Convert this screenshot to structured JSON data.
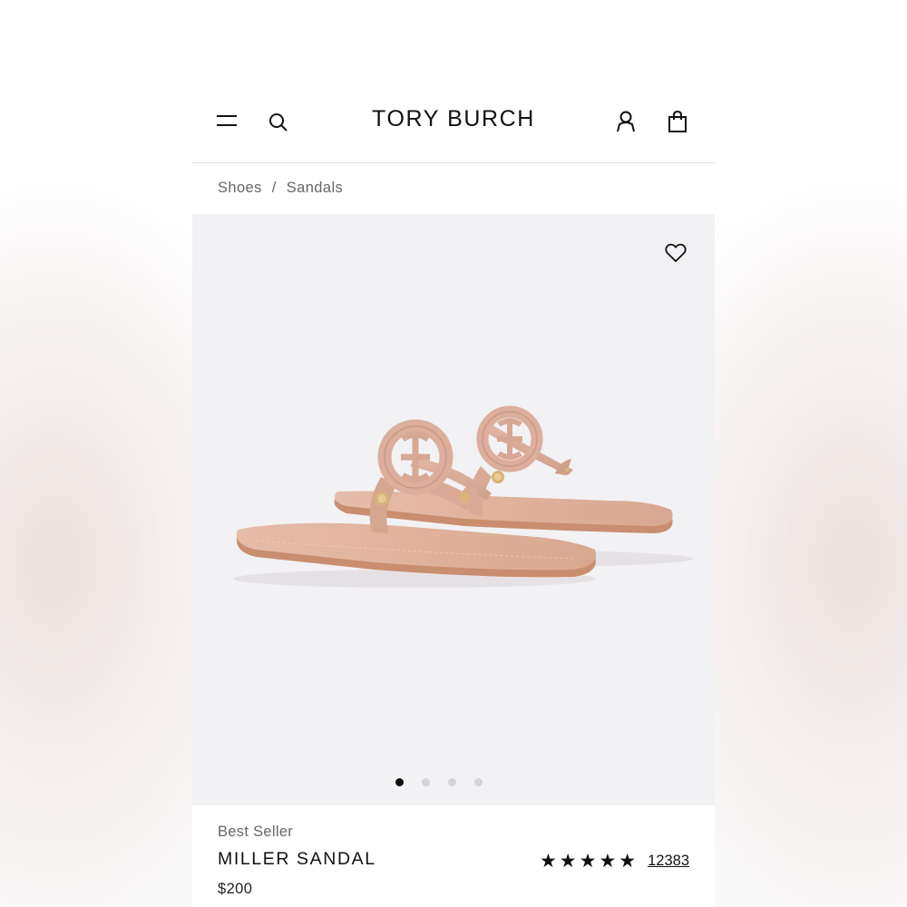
{
  "header": {
    "brand": "TORY BURCH",
    "icons": {
      "menu": "hamburger-menu-icon",
      "search": "search-icon",
      "account": "user-icon",
      "bag": "shopping-bag-icon"
    }
  },
  "breadcrumb": {
    "items": [
      "Shoes",
      "Sandals"
    ],
    "separator": "/"
  },
  "gallery": {
    "image": "tan-leather-thong-sandal-pair",
    "wishlist_icon": "heart-icon",
    "slide_count": 4,
    "active_slide": 1
  },
  "product": {
    "badge": "Best Seller",
    "name": "MILLER SANDAL",
    "price": "$200",
    "rating_stars": 5,
    "review_count": "12383"
  },
  "colors": {
    "gallery_bg": "#f2f1f4",
    "sandal_leather": "#dcae9b",
    "sole": "#c98e6f",
    "text_primary": "#111111",
    "text_secondary": "#666666"
  }
}
